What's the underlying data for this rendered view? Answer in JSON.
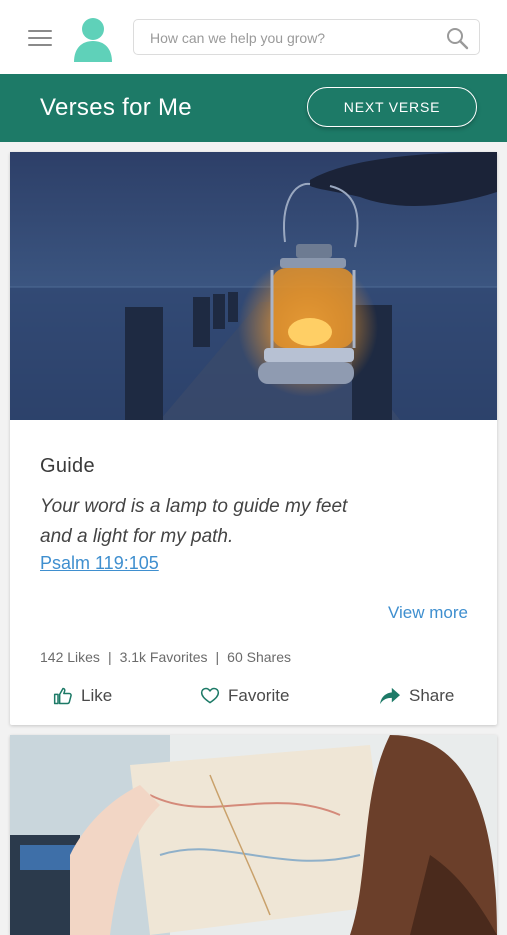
{
  "header": {
    "search_placeholder": "How can we help you grow?"
  },
  "banner": {
    "title": "Verses for Me",
    "next_label": "NEXT VERSE"
  },
  "card": {
    "title": "Guide",
    "verse_line1": "Your word is a lamp to guide my feet",
    "verse_line2": "and a light for my path.",
    "reference": "Psalm 119:105",
    "view_more": "View more",
    "likes": "142 Likes",
    "favorites": "3.1k Favorites",
    "shares": "60 Shares",
    "separator": "|",
    "like_label": "Like",
    "favorite_label": "Favorite",
    "share_label": "Share"
  },
  "colors": {
    "accent": "#1d7a67",
    "avatar": "#5fd1b9",
    "link": "#3f8fcf"
  },
  "icons": [
    "menu-icon",
    "avatar-icon",
    "search-icon",
    "thumbs-up-icon",
    "heart-icon",
    "share-arrow-icon"
  ]
}
